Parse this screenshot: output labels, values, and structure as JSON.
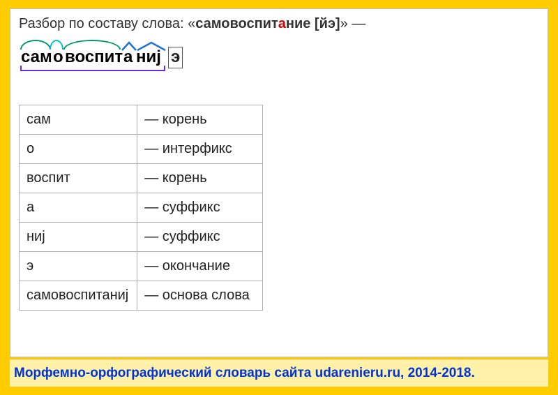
{
  "title": {
    "prefix": "Разбор по составу слова: «",
    "word_before_stress": "самовоспит",
    "stress_letter": "а",
    "word_after_stress": "ние [йэ]",
    "suffix": "» —"
  },
  "diagram": {
    "seg_sam": "сам",
    "seg_o": "о",
    "seg_vospit": "воспит",
    "seg_a": "а",
    "seg_nij": "ниj",
    "seg_e": "э"
  },
  "table": {
    "rows": [
      {
        "morph": "сам",
        "desc": "— корень"
      },
      {
        "morph": "о",
        "desc": "— интерфикс"
      },
      {
        "morph": "воспит",
        "desc": "— корень"
      },
      {
        "morph": "а",
        "desc": "— суффикс"
      },
      {
        "morph": "ниj",
        "desc": "— суффикс"
      },
      {
        "morph": "э",
        "desc": "— окончание"
      },
      {
        "morph": "самовоспитаниj",
        "desc": "— основа слова"
      }
    ]
  },
  "footer": "Морфемно-орфографический словарь сайта udarenieru.ru, 2014-2018."
}
